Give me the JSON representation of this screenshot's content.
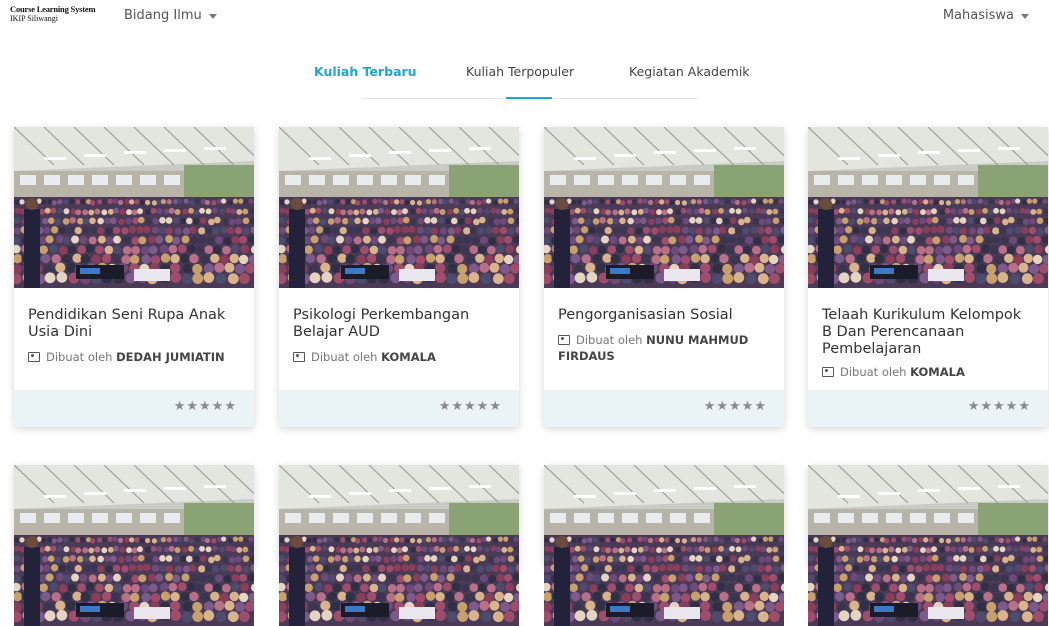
{
  "header": {
    "logo_line1": "Course Learning System",
    "logo_line2": "IKIP Siliwangi",
    "menu_left": "Bidang Ilmu",
    "menu_right": "Mahasiswa"
  },
  "tabs": [
    {
      "label": "Kuliah Terbaru",
      "active": true
    },
    {
      "label": "Kuliah Terpopuler",
      "active": false
    },
    {
      "label": "Kegiatan Akademik",
      "active": false
    }
  ],
  "author_prefix": "Dibuat oleh",
  "cards": [
    {
      "title": "Pendidikan Seni Rupa Anak Usia Dini",
      "author": "DEDAH JUMIATIN",
      "rating": "★★★★★"
    },
    {
      "title": "Psikologi Perkembangan Belajar AUD",
      "author": "KOMALA",
      "rating": "★★★★★"
    },
    {
      "title": "Pengorganisasian Sosial",
      "author": "NUNU MAHMUD FIRDAUS",
      "rating": "★★★★★"
    },
    {
      "title": "Telaah Kurikulum Kelompok B Dan Perencanaan Pembelajaran",
      "author": "KOMALA",
      "rating": "★★★★★"
    }
  ],
  "colors": {
    "accent": "#1ea7d4",
    "footer": "#eaf3f6"
  }
}
